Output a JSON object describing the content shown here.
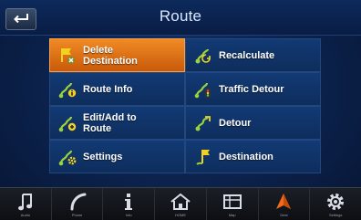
{
  "header": {
    "title": "Route",
    "back_icon": "back-arrow-icon"
  },
  "menu": {
    "items": [
      {
        "label": "Delete\nDestination",
        "icon": "delete-destination-icon",
        "selected": true
      },
      {
        "label": "Recalculate",
        "icon": "recalculate-icon",
        "selected": false
      },
      {
        "label": "Route Info",
        "icon": "route-info-icon",
        "selected": false
      },
      {
        "label": "Traffic Detour",
        "icon": "traffic-detour-icon",
        "selected": false
      },
      {
        "label": "Edit/Add to\nRoute",
        "icon": "edit-route-icon",
        "selected": false
      },
      {
        "label": "Detour",
        "icon": "detour-icon",
        "selected": false
      },
      {
        "label": "Settings",
        "icon": "route-settings-icon",
        "selected": false
      },
      {
        "label": "Destination",
        "icon": "destination-flag-icon",
        "selected": false
      }
    ]
  },
  "bottom_bar": {
    "tabs": [
      {
        "label": "Audio",
        "icon": "music-note-icon"
      },
      {
        "label": "Phone",
        "icon": "phone-icon"
      },
      {
        "label": "Info",
        "icon": "info-icon"
      },
      {
        "label": "HOME",
        "icon": "home-icon"
      },
      {
        "label": "Map",
        "icon": "map-icon"
      },
      {
        "label": "Dest",
        "icon": "navigation-arrow-icon"
      },
      {
        "label": "Settings",
        "icon": "gear-icon"
      }
    ]
  },
  "colors": {
    "selected": "#e07418",
    "cell": "#123a74",
    "icon_green": "#9bd23c",
    "icon_yellow": "#f2d21e",
    "nav_orange": "#f26b1d"
  }
}
